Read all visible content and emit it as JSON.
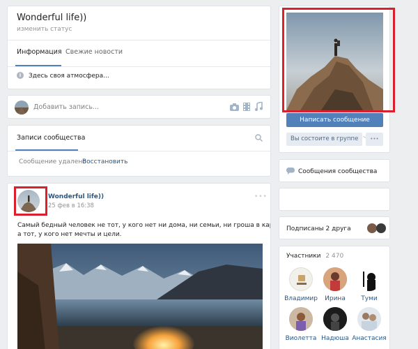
{
  "header": {
    "title": "Wonderful life))",
    "status_link": "изменить статус"
  },
  "tabs": [
    {
      "label": "Информация"
    },
    {
      "label": "Свежие новости"
    }
  ],
  "info": {
    "description": "Здесь своя атмосфера..."
  },
  "post_box": {
    "placeholder": "Добавить запись..."
  },
  "community_posts": {
    "title": "Записи сообщества",
    "deleted_text": "Сообщение удалено",
    "restore_link": "Восстановить"
  },
  "post": {
    "author": "Wonderful life))",
    "date": "25 фев в 16:38",
    "text_line1": "Самый бедный человек не тот, у кого нет ни дома, ни семьи, ни гроша в кармане,",
    "text_line2": "а тот, у кого нет мечты и цели."
  },
  "sidebar": {
    "write_button": "Написать сообщение",
    "membership_button": "Вы состоите в группе",
    "more_button": "•••",
    "community_messages": "Сообщения сообщества",
    "friends_subscribed": "Подписаны 2 друга",
    "members_title": "Участники",
    "members_count": "2 470",
    "members": [
      {
        "name": "Владимир"
      },
      {
        "name": "Ирина"
      },
      {
        "name": "Туми"
      },
      {
        "name": "Виолетта"
      },
      {
        "name": "Надюша"
      },
      {
        "name": "Анастасия"
      }
    ]
  },
  "colors": {
    "accent": "#5181b8",
    "link": "#2a5885",
    "highlight": "#d9202c"
  }
}
